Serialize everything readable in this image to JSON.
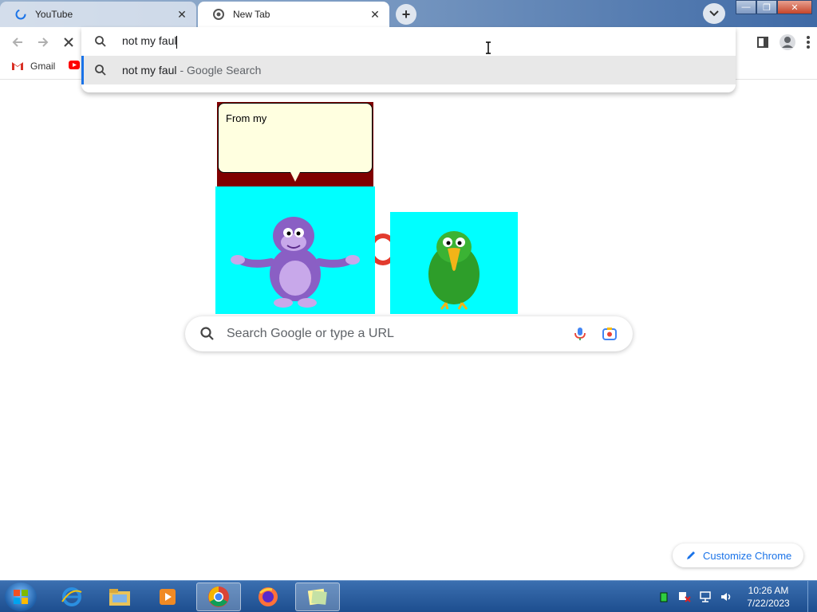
{
  "tabs": [
    {
      "title": "YouTube",
      "state": "loading",
      "active": false
    },
    {
      "title": "New Tab",
      "state": "loaded",
      "active": true
    }
  ],
  "omnibox": {
    "query": "not my faul",
    "suggestion_text": "not my faul",
    "suggestion_suffix": "- Google Search"
  },
  "bookmarks": [
    {
      "label": "Gmail",
      "icon": "gmail-icon"
    },
    {
      "label": "",
      "icon": "youtube-icon"
    }
  ],
  "bonzi": {
    "speech": "From my"
  },
  "search": {
    "placeholder": "Search Google or type a URL"
  },
  "customize": {
    "label": "Customize Chrome"
  },
  "taskbar": {
    "apps": [
      "internet-explorer-icon",
      "file-explorer-icon",
      "media-player-icon",
      "chrome-icon",
      "firefox-icon",
      "sticky-notes-icon"
    ],
    "time": "10:26 AM",
    "date": "7/22/2023"
  },
  "colors": {
    "accent": "#1a73e8",
    "cyan_box": "#00ffff",
    "bubble_bg": "#ffffe0",
    "bubble_frame": "#800000"
  }
}
